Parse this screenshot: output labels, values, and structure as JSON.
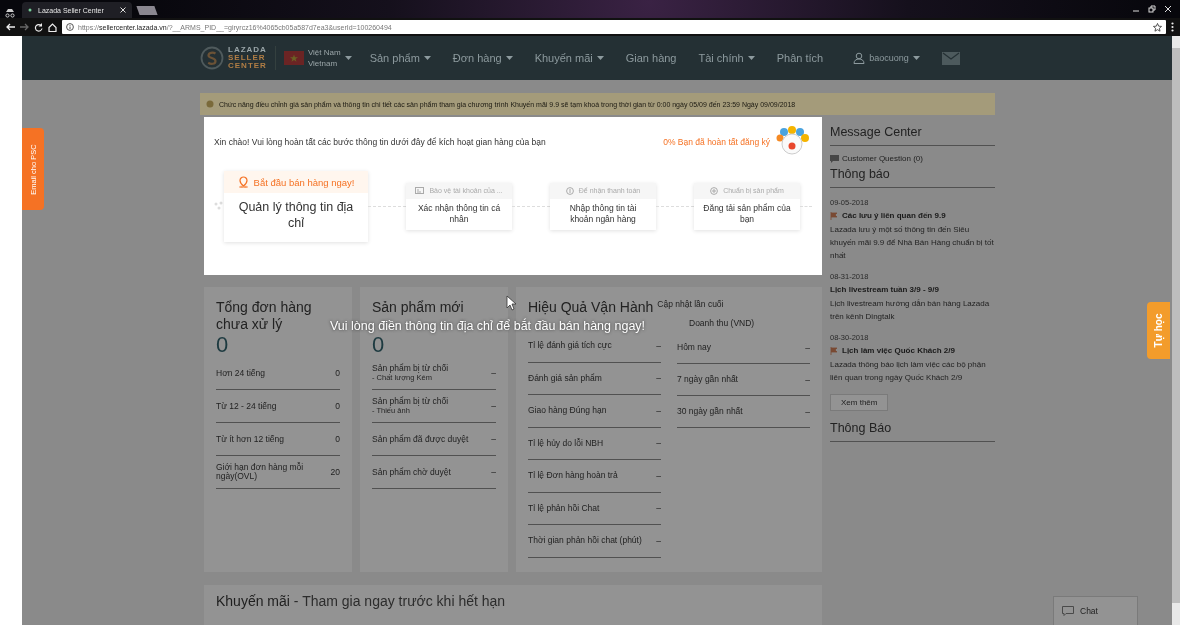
{
  "browser": {
    "tab_title": "Lazada Seller Center",
    "url_prefix": "https://",
    "url_host": "sellercenter.lazada.vn",
    "url_rest": "/?__ARMS_PID__=giryrcz16%4065cb05a587d7ea3&userId=100260494"
  },
  "nav": {
    "logo": [
      "LAZADA",
      "SELLER",
      "CENTER"
    ],
    "country": "Việt Nam",
    "country_sub": "Vietnam",
    "items": [
      {
        "label": "Sản phẩm",
        "dropdown": true
      },
      {
        "label": "Đơn hàng",
        "dropdown": true
      },
      {
        "label": "Khuyến mãi",
        "dropdown": true
      },
      {
        "label": "Gian hàng",
        "dropdown": false
      },
      {
        "label": "Tài chính",
        "dropdown": true
      },
      {
        "label": "Phân tích",
        "dropdown": false
      }
    ],
    "user": "baocuong"
  },
  "notice": "Chức năng điều chỉnh giá sản phẩm và thông tin chi tiết các sản phẩm tham gia chương trình Khuyến mãi 9.9 sẽ tạm khoá trong thời gian từ 0:00 ngày 05/09 đến 23:59 Ngày 09/09/2018",
  "side_tabs": {
    "left": "Email cho PSC",
    "right": "Tự học"
  },
  "onboarding": {
    "intro": "Xin chào! Vui lòng hoàn tất các bước thông tin dưới đây để kích hoạt gian hàng của bạn",
    "progress": "0% Bạn đã hoàn tất đăng ký",
    "steps": [
      {
        "title": "Bắt đầu bán hàng ngay!",
        "body": "Quản lý thông tin địa chỉ",
        "selected": true
      },
      {
        "title": "Bảo vệ tài khoản của ...",
        "body": "Xác nhận thông tin cá nhân",
        "selected": false
      },
      {
        "title": "Để nhận thanh toán",
        "body": "Nhập thông tin tài khoản ngân hàng",
        "selected": false
      },
      {
        "title": "Chuẩn bị sản phẩm",
        "body": "Đăng tải sản phẩm của bạn",
        "selected": false
      }
    ]
  },
  "overlay_message": "Vui lòng điền thông tin địa chỉ để bắt đầu bán hàng ngay!",
  "orders_card": {
    "title": "Tổng đơn hàng chưa xử lý",
    "count": "0",
    "rows": [
      {
        "label": "Hơn 24 tiếng",
        "value": "0"
      },
      {
        "label": "Từ 12 - 24 tiếng",
        "value": "0"
      },
      {
        "label": "Từ ít hơn 12 tiếng",
        "value": "0"
      },
      {
        "label": "Giới hạn đơn hàng mỗi ngày(OVL)",
        "value": "20"
      }
    ]
  },
  "products_card": {
    "title": "Sản phẩm mới",
    "count": "0",
    "rows": [
      {
        "label": "Sản phẩm bị từ chối",
        "sub": "- Chất lượng Kém",
        "value": "–"
      },
      {
        "label": "Sản phẩm bị từ chối",
        "sub": "- Thiếu ảnh",
        "value": "–"
      },
      {
        "label": "Sản phẩm đã được duyệt",
        "value": "–"
      },
      {
        "label": "Sản phẩm chờ duyệt",
        "value": "–"
      }
    ]
  },
  "performance_card": {
    "title": "Hiệu Quả Vận Hành",
    "updated": "Cập nhật lần cuối",
    "metrics": [
      {
        "label": "Tỉ lệ đánh giá tích cực",
        "value": "–"
      },
      {
        "label": "Đánh giá sản phẩm",
        "value": "–"
      },
      {
        "label": "Giao hàng Đúng hạn",
        "value": "–"
      },
      {
        "label": "Tỉ lệ hủy do lỗi NBH",
        "value": "–"
      },
      {
        "label": "Tỉ lệ Đơn hàng hoàn trả",
        "value": "–"
      },
      {
        "label": "Tỉ lệ phản hồi Chat",
        "value": "–"
      },
      {
        "label": "Thời gian phản hồi chat (phút)",
        "value": "–"
      }
    ],
    "revenue_title": "Doanh thu (VND)",
    "revenue": [
      {
        "label": "Hôm nay",
        "value": "–"
      },
      {
        "label": "7 ngày gần nhất",
        "value": "–"
      },
      {
        "label": "30 ngày gần nhất",
        "value": "–"
      }
    ]
  },
  "message_center": {
    "title": "Message Center",
    "customer_question": "Customer Question (0)",
    "notices_title": "Thông báo",
    "notices": [
      {
        "date": "09-05-2018",
        "title": "Các lưu ý liên quan đến 9.9",
        "body": "Lazada lưu ý một số thông tin đến Siêu khuyến mãi 9.9 để Nhà Bán Hàng chuẩn bị tốt nhất",
        "flagged": true
      },
      {
        "date": "08-31-2018",
        "title": "Lịch livestream tuần 3/9 - 9/9",
        "body": "Lịch livestream hướng dẫn bán hàng Lazada trên kênh Dingtalk",
        "flagged": false
      },
      {
        "date": "08-30-2018",
        "title": "Lịch làm việc Quốc Khách 2/9",
        "body": "Lazada thông báo lịch làm việc các bộ phận liên quan trong ngày Quốc Khách 2/9",
        "flagged": true
      }
    ],
    "more": "Xem thêm",
    "announcements_title": "Thông Báo"
  },
  "promo": {
    "title": "Khuyến mãi",
    "subtitle": " - Tham gia ngay trước khi hết hạn"
  },
  "chat": "Chat"
}
